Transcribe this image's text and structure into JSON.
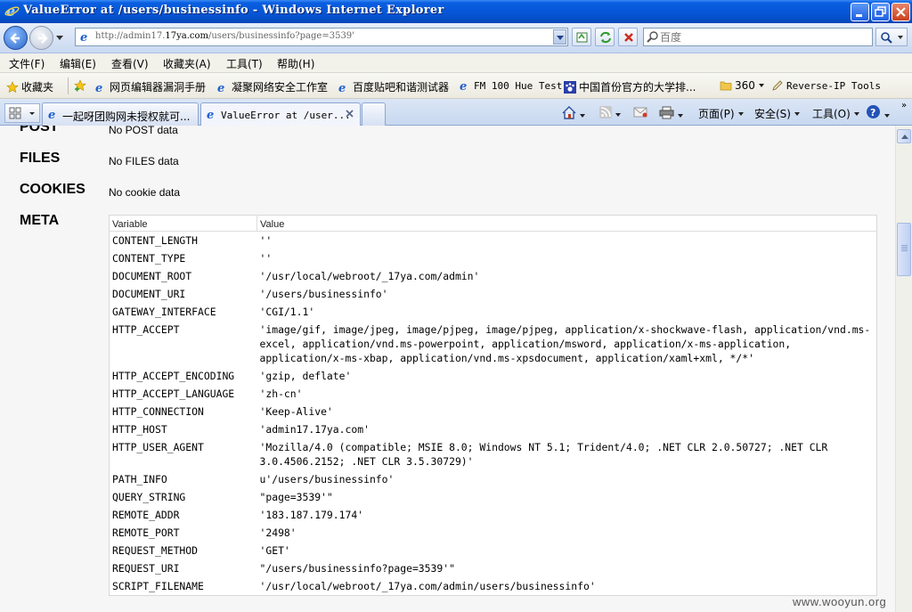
{
  "window": {
    "title": "ValueError at /users/businessinfo - Windows Internet Explorer"
  },
  "address": {
    "url_prefix": "http://admin17.",
    "url_host": "17ya.com",
    "url_path": "/users/businessinfo?page=3539'",
    "search_placeholder": "百度"
  },
  "menu": {
    "items": [
      "文件(F)",
      "编辑(E)",
      "查看(V)",
      "收藏夹(A)",
      "工具(T)",
      "帮助(H)"
    ]
  },
  "favorites": {
    "label": "收藏夹",
    "items": [
      "网页编辑器漏洞手册",
      "凝聚网络安全工作室",
      "百度贴吧和谐测试器",
      "FM 100 Hue Test",
      "中国首份官方的大学排...",
      "360",
      "Reverse-IP Tools"
    ]
  },
  "tabs": [
    {
      "label": "一起呀团购网未授权就可..."
    },
    {
      "label": "ValueError at /user..."
    }
  ],
  "command_bar": {
    "page": "页面(P)",
    "safety": "安全(S)",
    "tools": "工具(O)"
  },
  "sections": {
    "post": {
      "label": "POST",
      "value": "No POST data"
    },
    "files": {
      "label": "FILES",
      "value": "No FILES data"
    },
    "cookies": {
      "label": "COOKIES",
      "value": "No cookie data"
    },
    "meta": {
      "label": "META"
    }
  },
  "meta_table": {
    "headers": {
      "variable": "Variable",
      "value": "Value"
    },
    "rows": [
      {
        "variable": "CONTENT_LENGTH",
        "value": "''"
      },
      {
        "variable": "CONTENT_TYPE",
        "value": "''"
      },
      {
        "variable": "DOCUMENT_ROOT",
        "value": "'/usr/local/webroot/_17ya.com/admin'"
      },
      {
        "variable": "DOCUMENT_URI",
        "value": "'/users/businessinfo'"
      },
      {
        "variable": "GATEWAY_INTERFACE",
        "value": "'CGI/1.1'"
      },
      {
        "variable": "HTTP_ACCEPT",
        "value": "'image/gif, image/jpeg, image/pjpeg, image/pjpeg, application/x-shockwave-flash, application/vnd.ms-excel, application/vnd.ms-powerpoint, application/msword, application/x-ms-application, application/x-ms-xbap, application/vnd.ms-xpsdocument, application/xaml+xml, */*'"
      },
      {
        "variable": "HTTP_ACCEPT_ENCODING",
        "value": "'gzip, deflate'"
      },
      {
        "variable": "HTTP_ACCEPT_LANGUAGE",
        "value": "'zh-cn'"
      },
      {
        "variable": "HTTP_CONNECTION",
        "value": "'Keep-Alive'"
      },
      {
        "variable": "HTTP_HOST",
        "value": "'admin17.17ya.com'"
      },
      {
        "variable": "HTTP_USER_AGENT",
        "value": "'Mozilla/4.0 (compatible; MSIE 8.0; Windows NT 5.1; Trident/4.0; .NET CLR 2.0.50727; .NET CLR 3.0.4506.2152; .NET CLR 3.5.30729)'"
      },
      {
        "variable": "PATH_INFO",
        "value": "u'/users/businessinfo'"
      },
      {
        "variable": "QUERY_STRING",
        "value": "\"page=3539'\""
      },
      {
        "variable": "REMOTE_ADDR",
        "value": "'183.187.179.174'"
      },
      {
        "variable": "REMOTE_PORT",
        "value": "'2498'"
      },
      {
        "variable": "REQUEST_METHOD",
        "value": "'GET'"
      },
      {
        "variable": "REQUEST_URI",
        "value": "\"/users/businessinfo?page=3539'\""
      },
      {
        "variable": "SCRIPT_FILENAME",
        "value": "'/usr/local/webroot/_17ya.com/admin/users/businessinfo'"
      }
    ]
  },
  "watermark": "www.wooyun.org"
}
